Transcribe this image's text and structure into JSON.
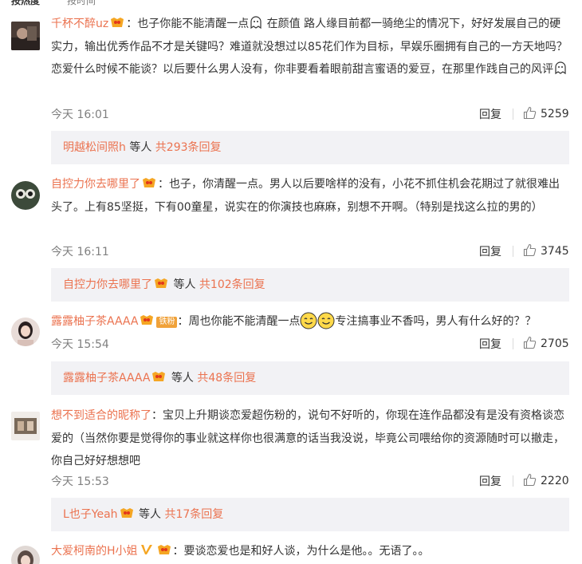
{
  "tabs": {
    "hot": "按热度",
    "time": "按时间"
  },
  "colors": {
    "username": "#eb7350",
    "subbox_bg": "#f2f2f5",
    "text": "#333333",
    "meta": "#808080"
  },
  "comments": [
    {
      "username": "千杯不醉uz",
      "text_1": "：也子你能不能清醒一点",
      "text_2": " 在颜值 路人缘目前都一骑绝尘的情况下，好好发展自己的硬实力，输出优秀作品不才是关键吗？难道就没想过以85花们作为目标，早娱乐圈拥有自己的一方天地吗？恋爱什么时候不能谈？以后要什么男人没有，你非要看着眼前甜言蜜语的爱豆，在那里作践自己的风评",
      "time": "今天 16:01",
      "reply_label": "回复",
      "likes": "5259",
      "sub_user": "明越松间照h",
      "sub_mid": " 等人 ",
      "sub_count": "共293条回复"
    },
    {
      "username": "自控力你去哪里了",
      "text": "：也子，你清醒一点。男人以后要啥样的没有，小花不抓住机会花期过了就很难出头了。上有85坚挺，下有00童星，说实在的你演技也麻麻，别想不开啊。（特别是找这么拉的男的）",
      "time": "今天 16:11",
      "reply_label": "回复",
      "likes": "3745",
      "sub_user": "自控力你去哪里了",
      "sub_mid": " 等人 ",
      "sub_count": "共102条回复"
    },
    {
      "username": "露露柚子茶AAAA",
      "fan_badge": "铁粉",
      "text_1": "：周也你能不能清醒一点",
      "text_2": "专注搞事业不香吗，男人有什么好的？？",
      "time": "今天 15:54",
      "reply_label": "回复",
      "likes": "2705",
      "sub_user": "露露柚子茶AAAA",
      "sub_mid": " 等人 ",
      "sub_count": "共48条回复"
    },
    {
      "username": "想不到适合的昵称了",
      "text": "：宝贝上升期谈恋爱超伤粉的，说句不好听的，你现在连作品都没有是没有资格谈恋爱的（当然你要是觉得你的事业就这样你也很满意的话当我没说，毕竟公司喂给你的资源随时可以撤走，你自己好好想想吧",
      "time": "今天 15:53",
      "reply_label": "回复",
      "likes": "2220",
      "sub_user": "L也子Yeah",
      "sub_mid": " 等人 ",
      "sub_count": "共17条回复"
    },
    {
      "username": "大爱柯南的H小姐",
      "text": "：要谈恋爱也是和好人谈，为什么是他。。无语了。。"
    }
  ]
}
